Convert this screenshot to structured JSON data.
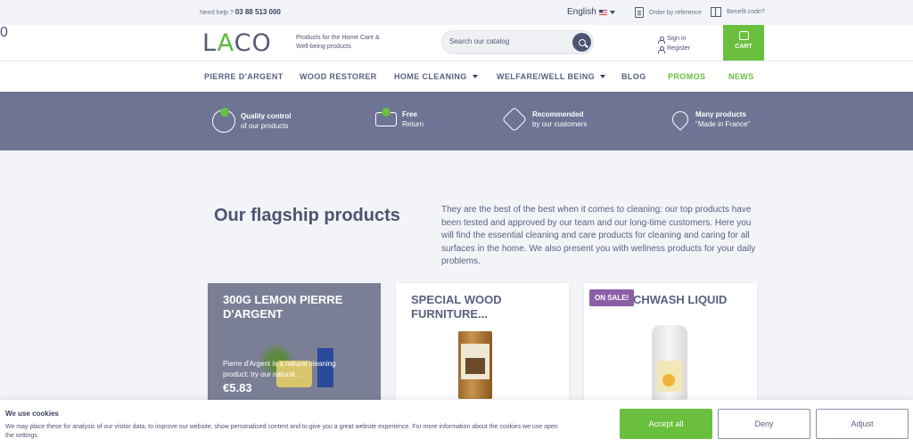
{
  "topbar": {
    "help_label": "Need help ? ",
    "phone": "03 88 513 000",
    "language": "English",
    "order_by_reference": "Order by reference",
    "benefit_code": "Benefit code?"
  },
  "header": {
    "logo_pre": "L",
    "logo_a": "A",
    "logo_post": "CO",
    "tagline": "Products for the Home Care & Well-being products",
    "search_placeholder": "Search our catalog",
    "sign_in": "Sign in",
    "register": "Register",
    "cart_label": "CART",
    "cart_count": "0"
  },
  "nav": {
    "items": [
      {
        "label": "PIERRE D'ARGENT"
      },
      {
        "label": "WOOD RESTORER"
      },
      {
        "label": "HOME CLEANING"
      },
      {
        "label": "WELFARE/WELL BEING"
      },
      {
        "label": "BLOG"
      },
      {
        "label": "PROMOS"
      },
      {
        "label": "NEWS"
      }
    ]
  },
  "features": [
    {
      "title": "Quality control",
      "sub": "of our products",
      "icon": "quality-check-icon"
    },
    {
      "title": "Free",
      "sub": "Return",
      "icon": "truck-icon"
    },
    {
      "title": "Recommended",
      "sub": "by our customers",
      "icon": "house-icon"
    },
    {
      "title": "Many products",
      "sub": "\"Made in France\"",
      "icon": "location-pin-icon"
    }
  ],
  "main": {
    "title": "Our flagship products",
    "intro": "They are the best of the best when it comes to cleaning: our top products have been tested and approved by our team and our long-time customers. Here you will find the essential cleaning and care products for cleaning and caring for all surfaces in the home. We also present you with wellness products for your daily problems."
  },
  "products": [
    {
      "title": "300G LEMON PIERRE D'ARGENT",
      "desc": "Pierre d'Argent is a  natural cleaning product: try our natural...",
      "price": "€5.83"
    },
    {
      "title": "SPECIAL WOOD FURNITURE..."
    },
    {
      "title": "CHWASH LIQUID",
      "badge": "ON SALE!"
    }
  ],
  "cookie": {
    "title": "We use cookies",
    "text": "We may place these for analysis of our visitor data, to improve our website, show personalised content and to give you a great website experience. For more information about the cookies we use open the settings.",
    "accept": "Accept all",
    "deny": "Deny",
    "adjust": "Adjust"
  },
  "colors": {
    "accent_green": "#6abf3e",
    "band": "#6e7493",
    "text": "#4d5472",
    "sale_badge": "#8a5fa8"
  }
}
